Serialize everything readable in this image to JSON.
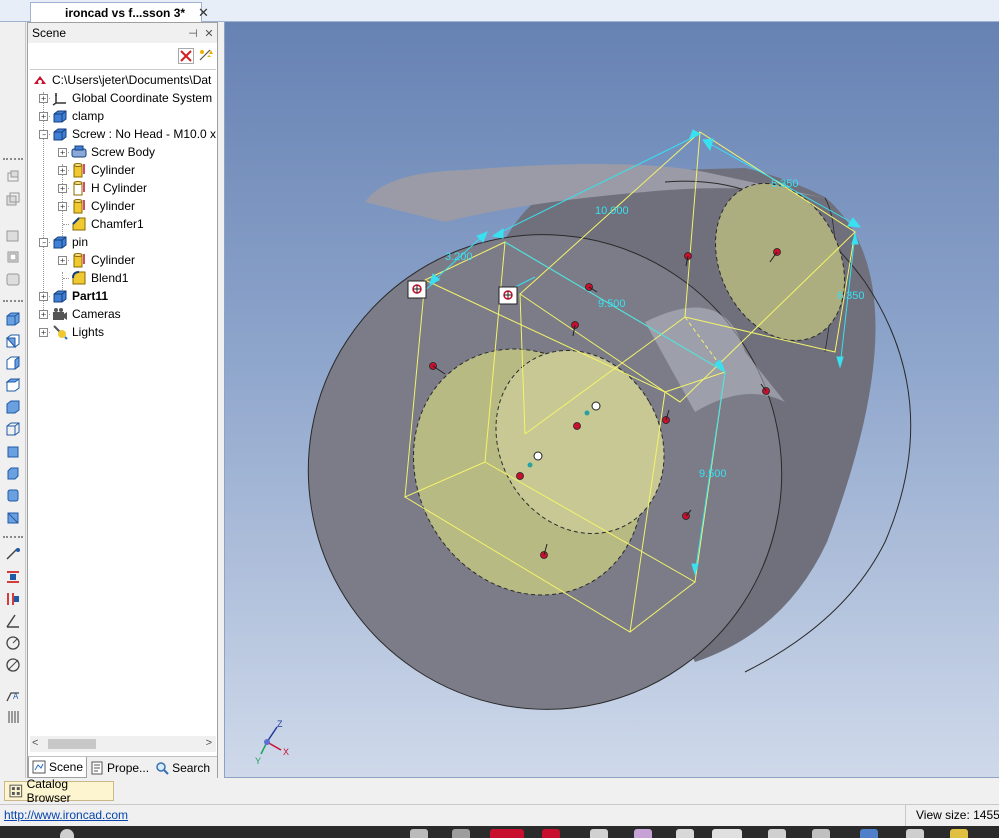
{
  "document": {
    "tab_title": "ironcad vs f...sson 3*",
    "close_glyph": "✕"
  },
  "scene_panel": {
    "title": "Scene",
    "pin_glyph": "⊣",
    "close_glyph": "✕",
    "filter_placeholder": "",
    "tree": [
      {
        "label": "C:\\Users\\jeter\\Documents\\Dat",
        "icon": "scene-root-icon",
        "depth": 0,
        "expander": "none"
      },
      {
        "label": "Global Coordinate System",
        "icon": "coordinate-system-icon",
        "depth": 1,
        "expander": "plus"
      },
      {
        "label": "clamp",
        "icon": "part-icon",
        "depth": 1,
        "expander": "plus"
      },
      {
        "label": "Screw : No Head - M10.0 x",
        "icon": "part-icon",
        "depth": 1,
        "expander": "minus"
      },
      {
        "label": "Screw Body",
        "icon": "screw-body-icon",
        "depth": 2,
        "expander": "plus"
      },
      {
        "label": "Cylinder",
        "icon": "cylinder-feature-icon",
        "depth": 2,
        "expander": "plus"
      },
      {
        "label": "H Cylinder",
        "icon": "hole-cylinder-icon",
        "depth": 2,
        "expander": "plus"
      },
      {
        "label": "Cylinder",
        "icon": "cylinder-feature-icon",
        "depth": 2,
        "expander": "plus"
      },
      {
        "label": "Chamfer1",
        "icon": "chamfer-icon",
        "depth": 2,
        "expander": "none"
      },
      {
        "label": "pin",
        "icon": "part-icon",
        "depth": 1,
        "expander": "minus"
      },
      {
        "label": "Cylinder",
        "icon": "cylinder-feature-icon",
        "depth": 2,
        "expander": "plus"
      },
      {
        "label": "Blend1",
        "icon": "blend-icon",
        "depth": 2,
        "expander": "none"
      },
      {
        "label": "Part11",
        "icon": "part-icon",
        "depth": 1,
        "expander": "plus",
        "bold": true
      },
      {
        "label": "Cameras",
        "icon": "cameras-icon",
        "depth": 1,
        "expander": "plus"
      },
      {
        "label": "Lights",
        "icon": "lights-icon",
        "depth": 1,
        "expander": "plus"
      }
    ],
    "tabs": [
      {
        "label": "Scene",
        "icon": "scene-tab-icon",
        "active": true
      },
      {
        "label": "Prope...",
        "icon": "properties-tab-icon",
        "active": false
      },
      {
        "label": "Search",
        "icon": "search-icon",
        "active": false
      }
    ]
  },
  "viewport": {
    "dimensions": [
      "6.350",
      "10.000",
      "3.200",
      "9.500",
      "6.350",
      "9.500"
    ],
    "axes": {
      "z": "Z",
      "y": "Y",
      "x": "X"
    }
  },
  "catalog": {
    "tab_label": "Catalog Browser"
  },
  "status": {
    "link": "http://www.ironcad.com",
    "view_size": "View size: 1455 x"
  },
  "colors": {
    "viewport_top": "#6682b3",
    "viewport_bottom": "#cfd9ea",
    "dimension": "#39e0f0",
    "triball_box": "#f4f46a",
    "handle": "#c8102e",
    "part_face": "#7b7c88"
  }
}
